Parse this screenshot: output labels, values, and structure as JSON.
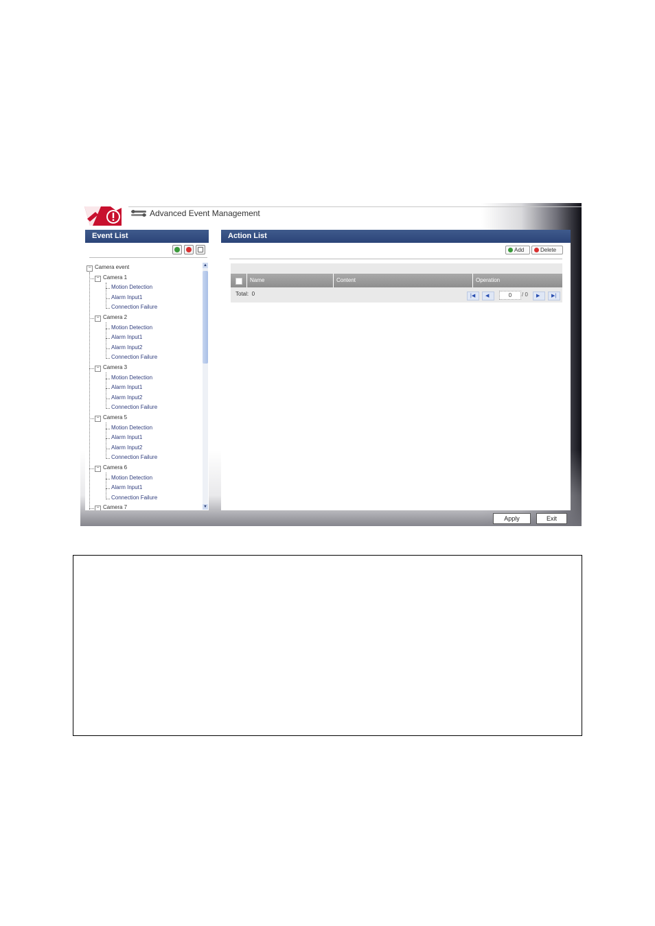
{
  "header": {
    "title": "Advanced Event Management"
  },
  "event_panel": {
    "title": "Event List",
    "toolbar": [
      {
        "name": "add-icon",
        "color": "#3a9a3a"
      },
      {
        "name": "delete-icon",
        "color": "#d83030"
      },
      {
        "name": "edit-icon",
        "color": "#666666"
      }
    ],
    "tree": {
      "root": "Camera event",
      "cameras": [
        {
          "label": "Camera 1",
          "items": [
            "Motion Detection",
            "Alarm Input1",
            "Connection Failure"
          ]
        },
        {
          "label": "Camera 2",
          "items": [
            "Motion Detection",
            "Alarm Input1",
            "Alarm Input2",
            "Connection Failure"
          ]
        },
        {
          "label": "Camera 3",
          "items": [
            "Motion Detection",
            "Alarm Input1",
            "Alarm Input2",
            "Connection Failure"
          ]
        },
        {
          "label": "Camera 5",
          "items": [
            "Motion Detection",
            "Alarm Input1",
            "Alarm Input2",
            "Connection Failure"
          ]
        },
        {
          "label": "Camera 6",
          "items": [
            "Motion Detection",
            "Alarm Input1",
            "Connection Failure"
          ]
        },
        {
          "label": "Camera 7",
          "items": []
        }
      ]
    }
  },
  "action_panel": {
    "title": "Action List",
    "add_label": "Add",
    "delete_label": "Delete",
    "columns": [
      "Name",
      "Content",
      "Operation"
    ],
    "total_label": "Total:",
    "total_value": "0",
    "page_current": "0",
    "page_total": "/ 0"
  },
  "footer": {
    "apply_label": "Apply",
    "exit_label": "Exit"
  },
  "colors": {
    "header_bar": "#2f4a7e",
    "leaf_text": "#2f3d7d",
    "grid_header": "#999999"
  }
}
